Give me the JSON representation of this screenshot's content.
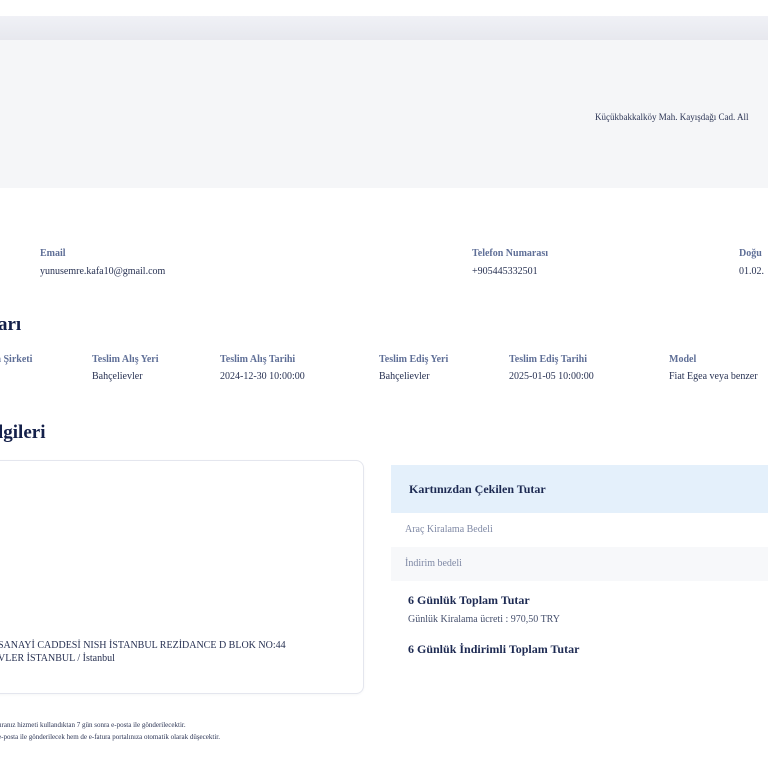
{
  "header": {
    "address": "Küçükbakkalköy Mah. Kayışdağı Cad. All"
  },
  "customer": {
    "email_label": "Email",
    "email_value": "yunusemre.kafa10@gmail.com",
    "phone_label": "Telefon Numarası",
    "phone_value": "+905445332501",
    "birth_label": "Doğu",
    "birth_value": "01.02."
  },
  "rental": {
    "section_title": "arı",
    "columns": [
      {
        "label": "a Şirketi",
        "value": ""
      },
      {
        "label": "Teslim Alış Yeri",
        "value": "Bahçelievler"
      },
      {
        "label": "Teslim Alış Tarihi",
        "value": "2024-12-30 10:00:00"
      },
      {
        "label": "Teslim Ediş Yeri",
        "value": "Bahçelievler"
      },
      {
        "label": "Teslim Ediş Tarihi",
        "value": "2025-01-05 10:00:00"
      },
      {
        "label": "Model",
        "value": "Fiat Egea veya benzer"
      }
    ]
  },
  "payment": {
    "section_title": "lgileri",
    "address_line1": "SANAYİ CADDESİ NISH İSTANBUL REZİDANCE D BLOK NO:44",
    "address_line2": "VLER İSTANBUL / İstanbul",
    "card_title": "Kartınızdan Çekilen Tutar",
    "row1": "Araç Kiralama Bedeli",
    "row2": "İndirim bedeli",
    "total_title": "6 Günlük Toplam Tutar",
    "total_sub": "Günlük Kiralama ücreti : 970,50 TRY",
    "discounted_total_title": "6 Günlük İndirimli Toplam Tutar"
  },
  "footnotes": {
    "line1": "uranız hizmeti kullandıktan 7 gün sonra e-posta ile gönderilecektir.",
    "line2": "e-posta ile gönderilecek hem de e-fatura portalınıza otomatik olarak düşecektir."
  }
}
